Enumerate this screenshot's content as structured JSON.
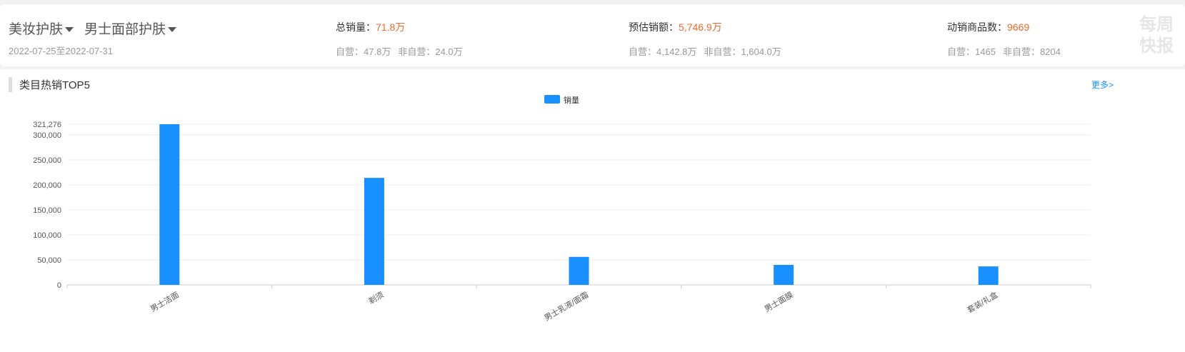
{
  "header": {
    "category1": "美妆护肤",
    "category2": "男士面部护肤",
    "date_range": "2022-07-25至2022-07-31",
    "total_sales": {
      "label": "总销量：",
      "value": "71.8万",
      "self_label": "自营：",
      "self_value": "47.8万",
      "other_label": "非自营：",
      "other_value": "24.0万"
    },
    "est_revenue": {
      "label": "预估销额：",
      "value": "5,746.9万",
      "self_label": "自营：",
      "self_value": "4,142.8万",
      "other_label": "非自营：",
      "other_value": "1,604.0万"
    },
    "active_items": {
      "label": "动销商品数：",
      "value": "9669",
      "self_label": "自营：",
      "self_value": "1465",
      "other_label": "非自营：",
      "other_value": "8204"
    },
    "watermark": "每周快报"
  },
  "panel": {
    "title": "类目热销TOP5",
    "more": "更多>"
  },
  "chart_data": {
    "type": "bar",
    "title": "类目热销TOP5",
    "legend": [
      "销量"
    ],
    "legend_position": "top-center",
    "categories": [
      "男士洁面",
      "剃须",
      "男士乳液/面霜",
      "男士面膜",
      "套装/礼盒"
    ],
    "series": [
      {
        "name": "销量",
        "values": [
          321276,
          214000,
          56000,
          40000,
          37000
        ],
        "color": "#1890ff"
      }
    ],
    "yticks": [
      0,
      50000,
      100000,
      150000,
      200000,
      250000,
      300000,
      321276
    ],
    "ytick_labels": [
      "0",
      "50,000",
      "100,000",
      "150,000",
      "200,000",
      "250,000",
      "300,000",
      "321,276"
    ],
    "ylim": [
      0,
      321276
    ],
    "grid": true
  }
}
